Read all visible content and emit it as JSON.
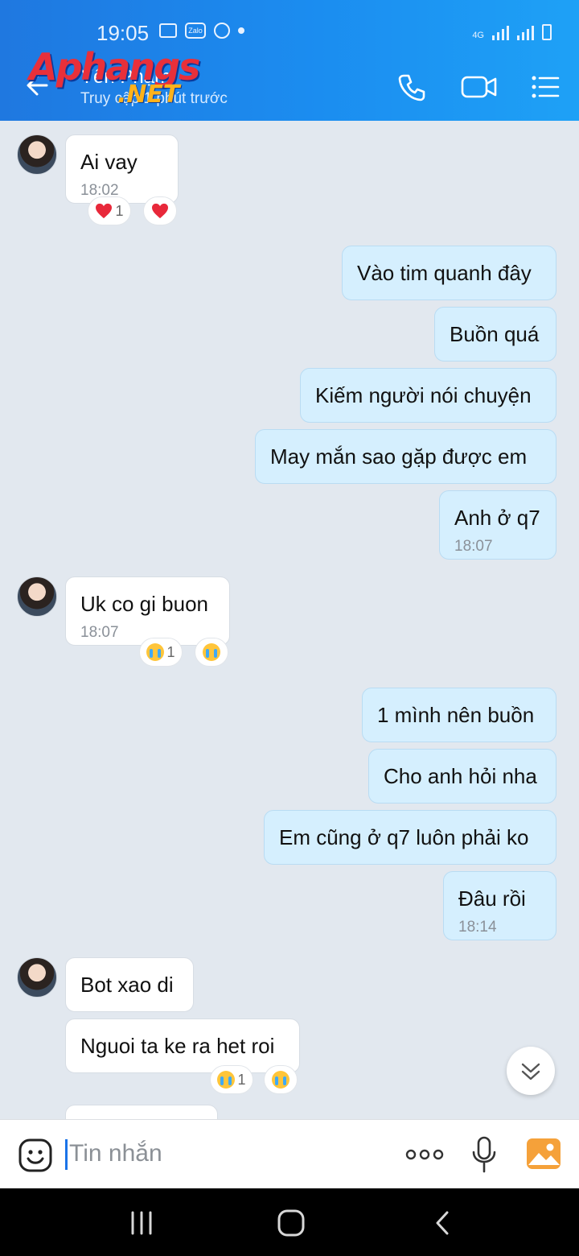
{
  "status_bar": {
    "time": "19:05",
    "zalo_icon_label": "Zalo",
    "network_label": "4G"
  },
  "header": {
    "contact_name": "Yến Phạm",
    "contact_status": "Truy cập 1 phút trước",
    "watermark_top": "Aphangs",
    "watermark_bottom": ".NET",
    "icons": [
      "back-arrow-icon",
      "phone-icon",
      "video-call-icon",
      "list-menu-icon"
    ]
  },
  "messages": [
    {
      "id": 1,
      "side": "in",
      "text": "Ai vay",
      "time": "18:02",
      "reactions": {
        "count": "1",
        "kind": "heart"
      }
    },
    {
      "id": 2,
      "side": "out",
      "text": "Vào tim quanh đây"
    },
    {
      "id": 3,
      "side": "out",
      "text": "Buồn quá"
    },
    {
      "id": 4,
      "side": "out",
      "text": "Kiếm người nói chuyện"
    },
    {
      "id": 5,
      "side": "out",
      "text": "May mắn sao gặp được em"
    },
    {
      "id": 6,
      "side": "out",
      "text": "Anh ở q7",
      "time": "18:07"
    },
    {
      "id": 7,
      "side": "in",
      "text": "Uk co gi buon",
      "time": "18:07",
      "reactions": {
        "count": "1",
        "kind": "cry"
      }
    },
    {
      "id": 8,
      "side": "out",
      "text": "1 mình nên buồn"
    },
    {
      "id": 9,
      "side": "out",
      "text": "Cho anh hỏi nha"
    },
    {
      "id": 10,
      "side": "out",
      "text": "Em cũng ở q7 luôn phải ko"
    },
    {
      "id": 11,
      "side": "out",
      "text": "Đâu rồi",
      "time": "18:14"
    },
    {
      "id": 12,
      "side": "in",
      "text": "Bot xao di"
    },
    {
      "id": 13,
      "side": "in",
      "text": "Nguoi ta ke ra het roi",
      "reactions": {
        "count": "1",
        "kind": "cry"
      }
    }
  ],
  "composer": {
    "placeholder": "Tin nhắn",
    "value": "",
    "icons": [
      "sticker-emoji-icon",
      "more-options-icon",
      "microphone-icon",
      "image-gallery-icon"
    ]
  },
  "colors": {
    "header_gradient_start": "#1f78e0",
    "header_gradient_end": "#1ea1f6",
    "chat_background": "#e2e8ef",
    "incoming_bubble": "#ffffff",
    "outgoing_bubble": "#d5effe",
    "timestamp": "#8a9098",
    "heart": "#e8283a",
    "accent": "#1a73e8"
  }
}
